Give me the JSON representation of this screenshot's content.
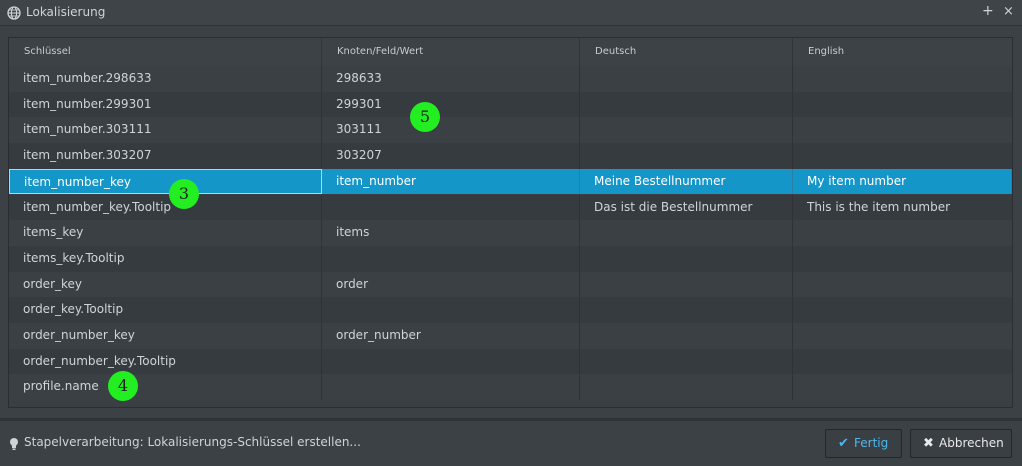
{
  "window": {
    "title": "Lokalisierung",
    "icon": "globe-icon",
    "add_label": "+",
    "close_label": "×"
  },
  "table": {
    "headers": [
      "Schlüssel",
      "Knoten/Feld/Wert",
      "Deutsch",
      "English"
    ],
    "rows": [
      {
        "key": "item_number.298633",
        "node": "298633",
        "de": "",
        "en": ""
      },
      {
        "key": "item_number.299301",
        "node": "299301",
        "de": "",
        "en": ""
      },
      {
        "key": "item_number.303111",
        "node": "303111",
        "de": "",
        "en": ""
      },
      {
        "key": "item_number.303207",
        "node": "303207",
        "de": "",
        "en": ""
      },
      {
        "key": "item_number_key",
        "node": "item_number",
        "de": "Meine Bestellnummer",
        "en": "My item number",
        "selected": true
      },
      {
        "key": "item_number_key.Tooltip",
        "node": "",
        "de": "Das ist die Bestellnummer",
        "en": "This is the item number"
      },
      {
        "key": "items_key",
        "node": "items",
        "de": "",
        "en": ""
      },
      {
        "key": "items_key.Tooltip",
        "node": "",
        "de": "",
        "en": ""
      },
      {
        "key": "order_key",
        "node": "order",
        "de": "",
        "en": ""
      },
      {
        "key": "order_key.Tooltip",
        "node": "",
        "de": "",
        "en": ""
      },
      {
        "key": "order_number_key",
        "node": "order_number",
        "de": "",
        "en": ""
      },
      {
        "key": "order_number_key.Tooltip",
        "node": "",
        "de": "",
        "en": ""
      },
      {
        "key": "profile.name",
        "node": "",
        "de": "",
        "en": ""
      }
    ]
  },
  "markers": [
    "3",
    "4",
    "5"
  ],
  "footer": {
    "status": "Stapelverarbeitung: Lokalisierungs-Schlüssel erstellen...",
    "status_icon": "lightbulb-icon",
    "ok_label": "Fertig",
    "ok_icon": "check-icon",
    "cancel_label": "Abbrechen",
    "cancel_icon": "x-icon"
  },
  "colors": {
    "selection": "#1596c9",
    "marker": "#22ee22",
    "ok_text": "#4fb7ee"
  }
}
